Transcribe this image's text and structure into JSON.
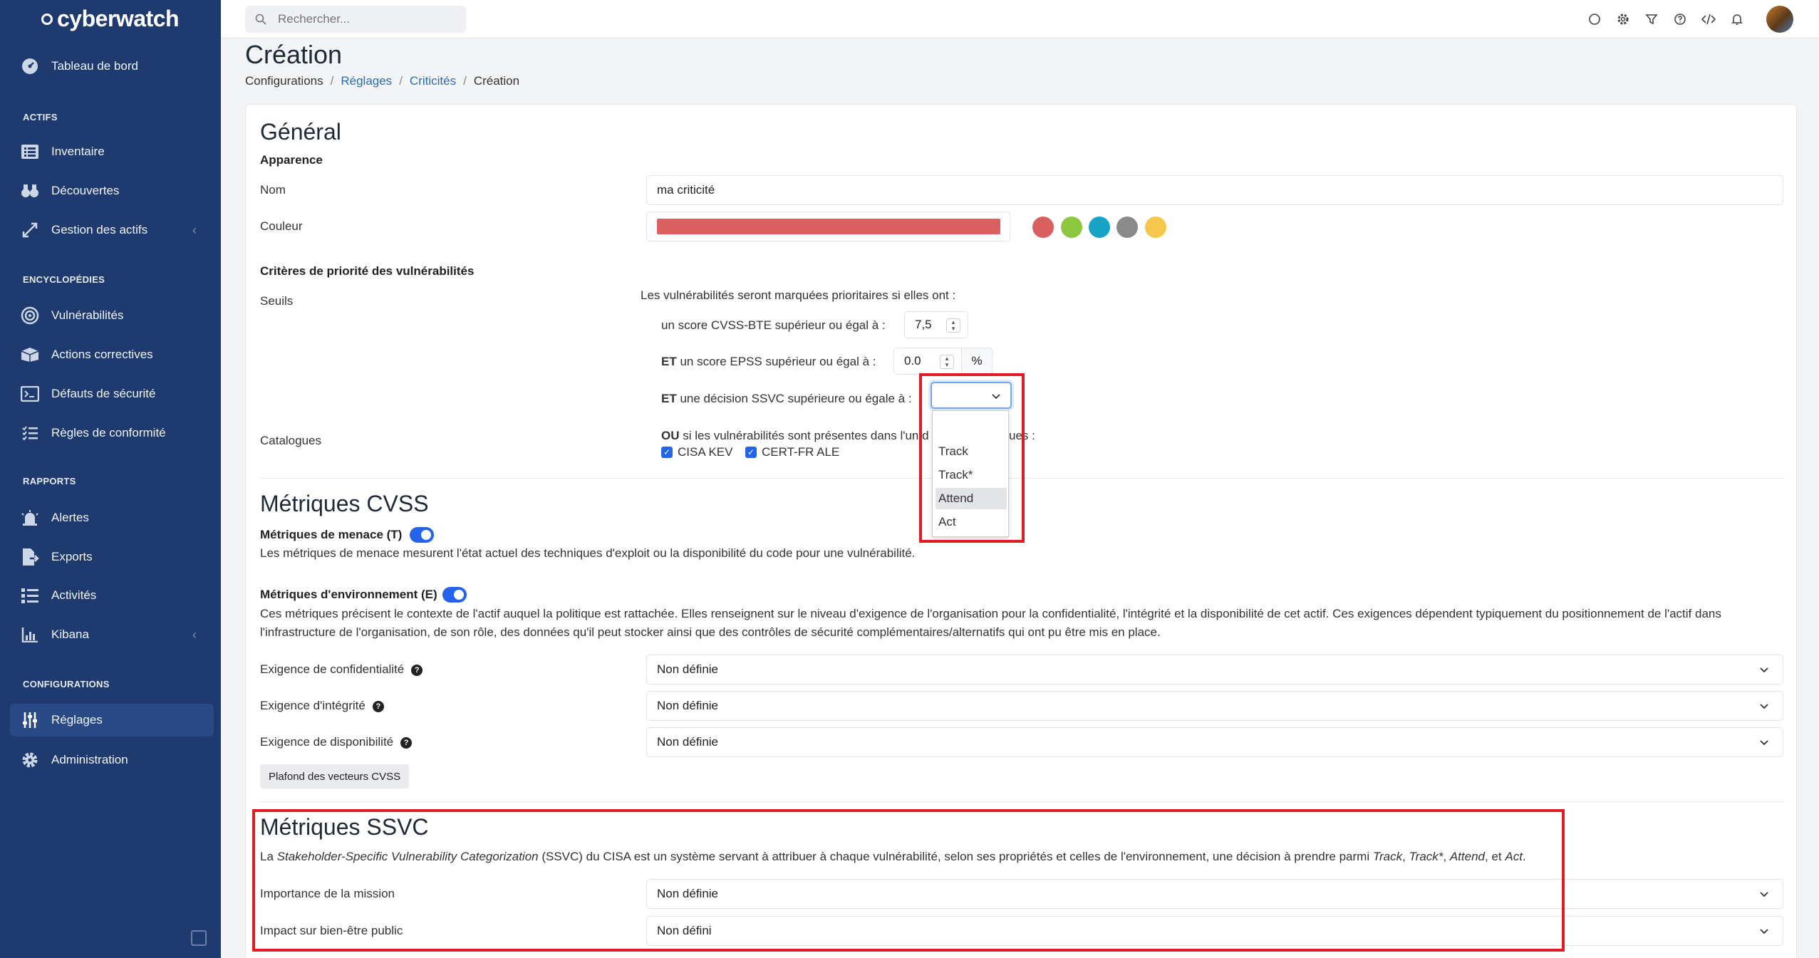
{
  "sidebar": {
    "brand": "cyberwatch",
    "dashboard": "Tableau de bord",
    "sections": {
      "actifs": "ACTIFS",
      "encyclopedies": "ENCYCLOPÉDIES",
      "rapports": "RAPPORTS",
      "configurations": "CONFIGURATIONS"
    },
    "items": {
      "inventaire": "Inventaire",
      "decouvertes": "Découvertes",
      "gestion": "Gestion des actifs",
      "vulnerabilites": "Vulnérabilités",
      "actions": "Actions correctives",
      "defauts": "Défauts de sécurité",
      "regles": "Règles de conformité",
      "alertes": "Alertes",
      "exports": "Exports",
      "activites": "Activités",
      "kibana": "Kibana",
      "reglages": "Réglages",
      "administration": "Administration"
    }
  },
  "topbar": {
    "search_placeholder": "Rechercher..."
  },
  "page": {
    "title": "Création",
    "breadcrumb": [
      "Configurations",
      "Réglages",
      "Criticités",
      "Création"
    ]
  },
  "general": {
    "title": "Général",
    "appearance": "Apparence",
    "name_label": "Nom",
    "name_value": "ma criticité",
    "color_label": "Couleur",
    "color_value": "#d9605f",
    "presets": [
      "#d9605f",
      "#8dc63f",
      "#17a2c8",
      "#8a8a8a",
      "#f5c84c"
    ]
  },
  "criteria": {
    "title": "Critères de priorité des vulnérabilités",
    "thresholds_label": "Seuils",
    "intro": "Les vulnérabilités seront marquées prioritaires si elles ont :",
    "cvss_label": "un score CVSS-BTE supérieur ou égal à :",
    "cvss_value": "7,5",
    "et": "ET",
    "epss_label": "un score EPSS supérieur ou égal à :",
    "epss_value": "0.0",
    "epss_unit": "%",
    "ssvc_label": "une décision SSVC supérieure ou égale à :",
    "ssvc_options": [
      "Track",
      "Track*",
      "Attend",
      "Act"
    ],
    "catalogs_label": "Catalogues",
    "ou": "OU",
    "catalogs_text_a": "si les vulnérabilités sont présentes dans l'un d",
    "catalogs_text_b": "ues :",
    "catalog1": "CISA KEV",
    "catalog2": "CERT-FR ALE"
  },
  "cvss": {
    "title": "Métriques CVSS",
    "threat_label": "Métriques de menace (T)",
    "threat_desc": "Les métriques de menace mesurent l'état actuel des techniques d'exploit ou la disponibilité du code pour une vulnérabilité.",
    "env_label": "Métriques d'environnement (E)",
    "env_desc_1": "Ces métriques précisent le contexte de l'actif auquel la politique est rattachée. Elles renseignent sur le niveau d'exigence de l'organisation pour la confidentialité, l'intégrité et la disponibilité de cet actif. Ces exigences dépendent typiquement du positionnement de l'actif dans",
    "env_desc_2": "l'infrastructure de l'organisation, de son rôle, des données qu'il peut stocker ainsi que des contrôles de sécurité complémentaires/alternatifs qui ont pu être mis en place.",
    "conf_label": "Exigence de confidentialité",
    "conf_value": "Non définie",
    "integ_label": "Exigence d'intégrité",
    "integ_value": "Non définie",
    "dispo_label": "Exigence de disponibilité",
    "dispo_value": "Non définie",
    "ceiling_button": "Plafond des vecteurs CVSS"
  },
  "ssvc": {
    "title": "Métriques SSVC",
    "desc_pre": "La ",
    "desc_em": "Stakeholder-Specific Vulnerability Categorization",
    "desc_mid": " (SSVC) du CISA est un système servant à attribuer à chaque vulnérabilité, selon ses propriétés et celles de l'environnement, une décision à prendre parmi ",
    "d1": "Track",
    "d2": "Track*",
    "d3": "Attend",
    "desc_and": ", et ",
    "d4": "Act",
    "comma": ", ",
    "dot": ".",
    "mission_label": "Importance de la mission",
    "mission_value": "Non définie",
    "impact_label": "Impact sur bien-être public",
    "impact_value": "Non défini"
  }
}
